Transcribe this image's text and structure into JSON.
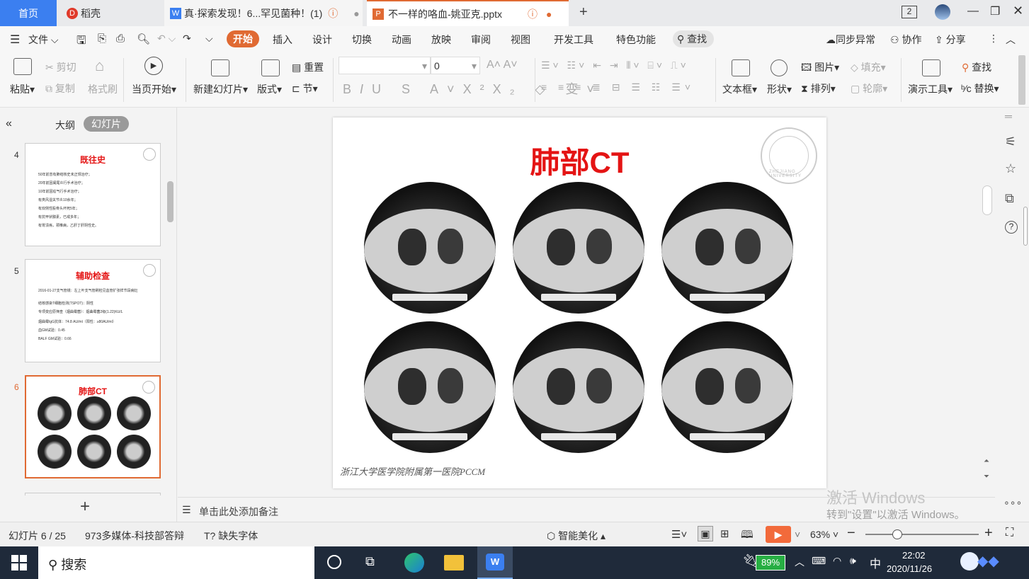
{
  "tabs": [
    {
      "label": "首页"
    },
    {
      "label": "稻壳"
    },
    {
      "label": "真·探索发现！6...罕见菌种！(1)"
    },
    {
      "label": "不一样的咯血-姚亚克.pptx"
    }
  ],
  "window": {
    "badge": "2"
  },
  "menu": {
    "file": "文件",
    "items": [
      "开始",
      "插入",
      "设计",
      "切换",
      "动画",
      "放映",
      "审阅",
      "视图",
      "开发工具",
      "特色功能"
    ],
    "search": "查找",
    "sync": "同步异常",
    "collab": "协作",
    "share": "分享"
  },
  "ribbon": {
    "paste": "粘贴",
    "cut": "剪切",
    "copy": "复制",
    "format_painter": "格式刷",
    "from_current": "当页开始",
    "new_slide": "新建幻灯片",
    "layout": "版式",
    "reset": "重置",
    "section": "节",
    "font_size": "0",
    "textbox": "文本框",
    "shape": "形状",
    "picture": "图片",
    "fill": "填充",
    "arrange": "排列",
    "outline": "轮廓",
    "presenter_tools": "演示工具",
    "find": "查找",
    "replace": "替换"
  },
  "leftpane": {
    "outline_tab": "大纲",
    "slides_tab": "幻灯片",
    "slides": [
      {
        "num": "4",
        "title": "既往史",
        "lines": [
          "50年前曾有肺结核史未正规治疗；",
          "20年前因阑尾炎行手术治疗；",
          "10年前因疝气行手术治疗；",
          "有类风湿关节炎10余年；",
          "有双侧性股骨头坏死5年；",
          "有抗甲状腺素，已戒多年；",
          "有胃溃疡，颈椎病，乙肝丁肝阴性史。"
        ]
      },
      {
        "num": "5",
        "title": "辅助检查",
        "lines": [
          "2016-01-27支气管镜：左上叶支气管刷检见血管扩张样节段病灶",
          "结核感染T细胞检测(TSPOT)：阴性",
          "专项变应原筛查（烟曲霉菌）：烟曲霉菌2级(1.22)KU/L",
          "烟曲霉IgG抗体：74.8 AU/ml（阳性：≥80AU/ml）",
          "血GM试验：0.45",
          "BALF GM试验：0.66"
        ]
      },
      {
        "num": "6",
        "title": "肺部CT"
      }
    ],
    "add": "+"
  },
  "notes_placeholder": "单击此处添加备注",
  "slide": {
    "title": "肺部CT",
    "footer": "浙江大学医学院附属第一医院PCCM",
    "logo_text": "ZHEJIANG UNIVERSITY"
  },
  "watermark": {
    "line1": "激活 Windows",
    "line2": "转到\"设置\"以激活 Windows。"
  },
  "status": {
    "slide_num": "幻灯片 6 / 25",
    "theme": "973多媒体-科技部答辩",
    "missing_font": "缺失字体",
    "smart": "智能美化",
    "zoom": "63%"
  },
  "taskbar": {
    "search": "搜索",
    "battery": "89%",
    "ime": "中",
    "time": "22:02",
    "date": "2020/11/26"
  },
  "colors": {
    "accent": "#e06a33",
    "title_red": "#e41414",
    "home_blue": "#3b7ff0"
  }
}
